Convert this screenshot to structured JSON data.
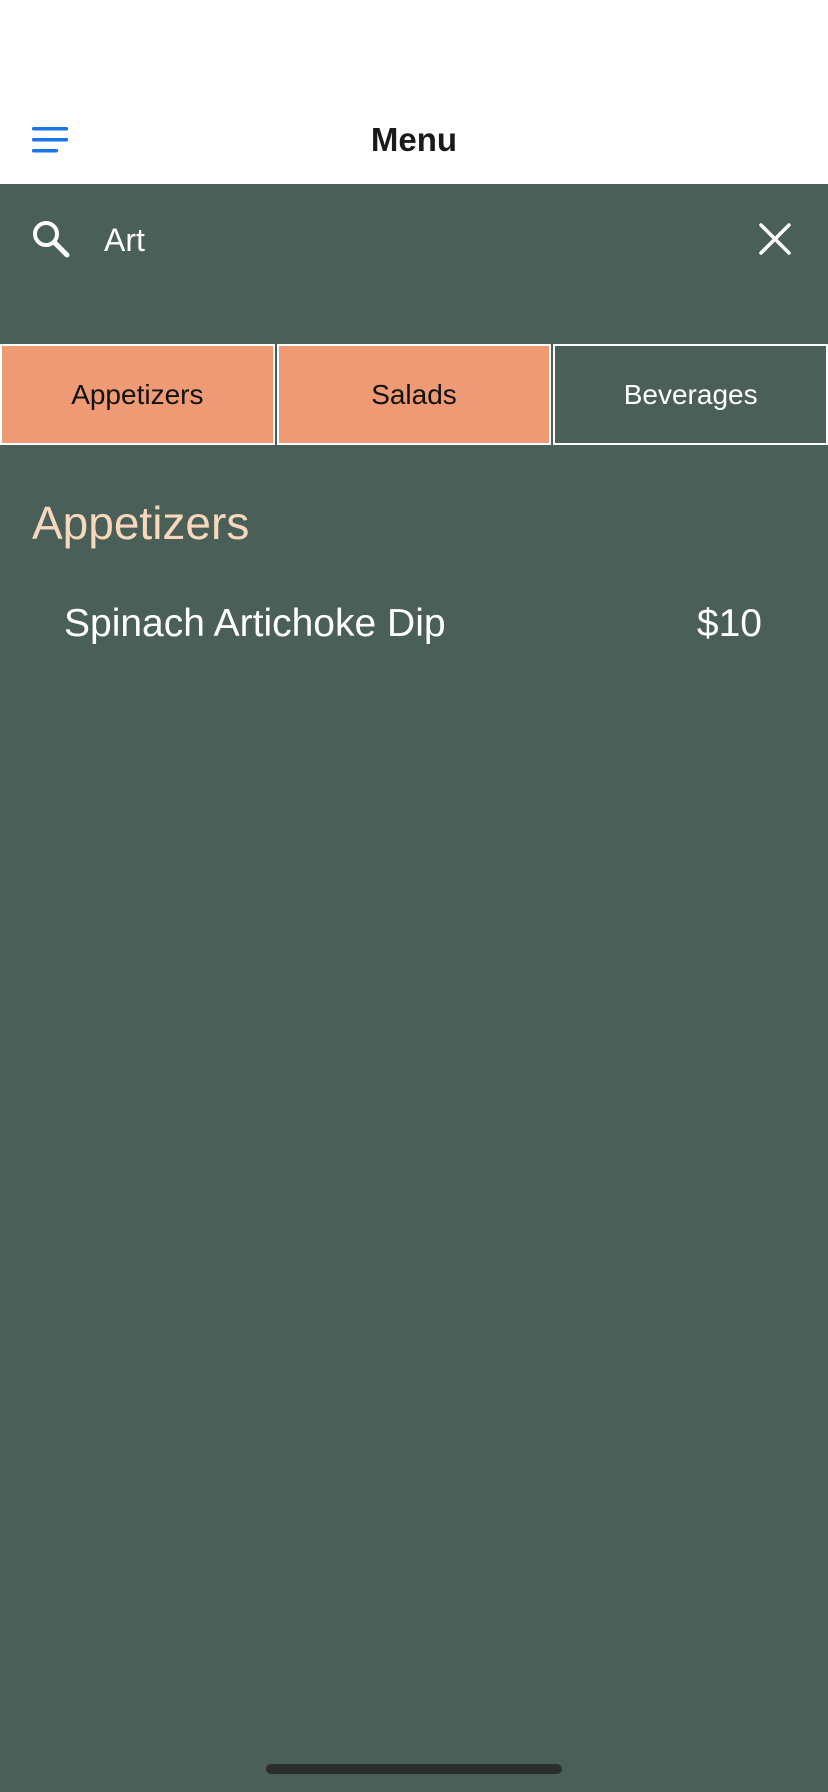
{
  "header": {
    "title": "Menu",
    "menu_icon": "hamburger-menu-icon"
  },
  "search": {
    "value": "Art",
    "placeholder": "",
    "search_icon": "search-icon",
    "clear_icon": "close-icon"
  },
  "tabs": [
    {
      "label": "Appetizers",
      "state": "selected"
    },
    {
      "label": "Salads",
      "state": "selected"
    },
    {
      "label": "Beverages",
      "state": "unselected"
    }
  ],
  "sections": [
    {
      "title": "Appetizers",
      "items": [
        {
          "name": "Spinach Artichoke Dip",
          "price": "$10"
        }
      ]
    }
  ],
  "colors": {
    "background": "#4a5f57",
    "header_background": "#ffffff",
    "accent": "#1a73e8",
    "selected_tab": "#ee9a74",
    "section_title": "#f7d8bd",
    "text_light": "#ffffff"
  }
}
